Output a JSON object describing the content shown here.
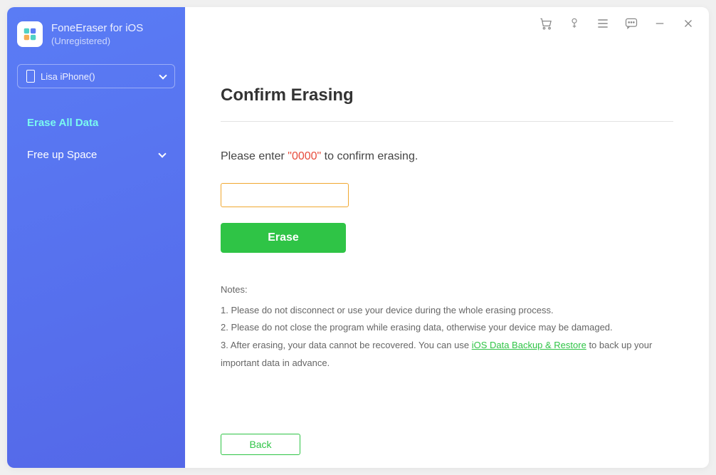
{
  "app": {
    "title": "FoneEraser for iOS",
    "subtitle": "(Unregistered)"
  },
  "device": {
    "name": "Lisa iPhone()"
  },
  "nav": {
    "erase_all": "Erase All Data",
    "free_up": "Free up Space"
  },
  "main": {
    "title": "Confirm Erasing",
    "instruction_prefix": "Please enter ",
    "instruction_code": "\"0000\"",
    "instruction_suffix": " to confirm erasing.",
    "erase_button": "Erase",
    "back_button": "Back"
  },
  "notes": {
    "title": "Notes:",
    "note1": "1. Please do not disconnect or use your device during the whole erasing process.",
    "note2": "2. Please do not close the program while erasing data, otherwise your device may be damaged.",
    "note3_prefix": "3. After erasing, your data cannot be recovered. You can use ",
    "note3_link": "iOS Data Backup & Restore",
    "note3_suffix": " to back up your important data in advance."
  }
}
